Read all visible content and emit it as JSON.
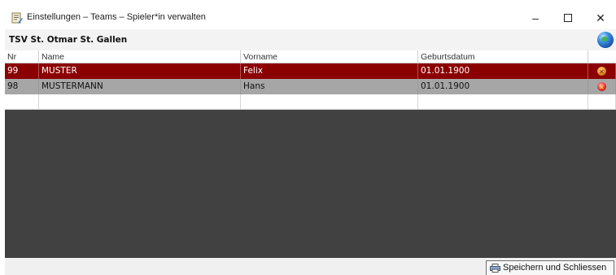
{
  "window": {
    "title": "Einstellungen – Teams – Spieler*in verwalten",
    "minimize_glyph": "–",
    "close_glyph": "✕"
  },
  "team": {
    "name": "TSV St. Otmar St. Gallen"
  },
  "grid": {
    "columns": [
      "Nr",
      "Name",
      "Vorname",
      "Geburtsdatum",
      ""
    ],
    "rows": [
      {
        "nr": "99",
        "name": "MUSTER",
        "vorname": "Felix",
        "geburtsdatum": "01.01.1900",
        "selected": true
      },
      {
        "nr": "98",
        "name": "MUSTERMANN",
        "vorname": "Hans",
        "geburtsdatum": "01.01.1900",
        "selected": false
      }
    ]
  },
  "colors": {
    "selected_row": "#8b0000",
    "normal_row": "#a6a6a6",
    "grid_background": "#414141"
  },
  "icons": {
    "app": "settings-document-icon",
    "team": "globe-icon",
    "row_action": "delete-icon",
    "save": "printer-icon"
  },
  "footer": {
    "save_label": "Speichern und Schliessen"
  }
}
